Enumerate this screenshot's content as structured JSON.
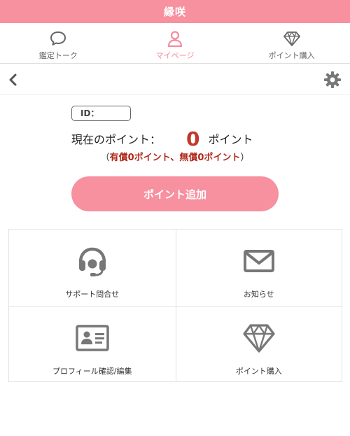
{
  "app": {
    "title": "縁咲"
  },
  "tabs": [
    {
      "label": "鑑定トーク",
      "icon": "chat-bubble-icon",
      "active": false
    },
    {
      "label": "マイページ",
      "icon": "person-icon",
      "active": true
    },
    {
      "label": "ポイント購入",
      "icon": "diamond-icon",
      "active": false
    }
  ],
  "nav": {
    "back_icon": "chevron-left-icon",
    "settings_icon": "gear-icon"
  },
  "account": {
    "id_label": "ID：",
    "points_prefix": "現在のポイント：",
    "points_value": "0",
    "points_unit": "ポイント",
    "breakdown_open": "（",
    "breakdown_text": "有償0ポイント、無償0ポイント",
    "breakdown_close": "）"
  },
  "add_points_button": "ポイント追加",
  "menu": [
    {
      "label": "サポート問合せ",
      "icon": "headset-icon"
    },
    {
      "label": "お知らせ",
      "icon": "envelope-icon"
    },
    {
      "label": "プロフィール確認/編集",
      "icon": "id-card-icon"
    },
    {
      "label": "ポイント購入",
      "icon": "diamond-icon"
    }
  ],
  "colors": {
    "brand_pink": "#f7909f",
    "active_tab": "#f58aa0",
    "points_red": "#c0392b",
    "icon_gray": "#777777"
  }
}
